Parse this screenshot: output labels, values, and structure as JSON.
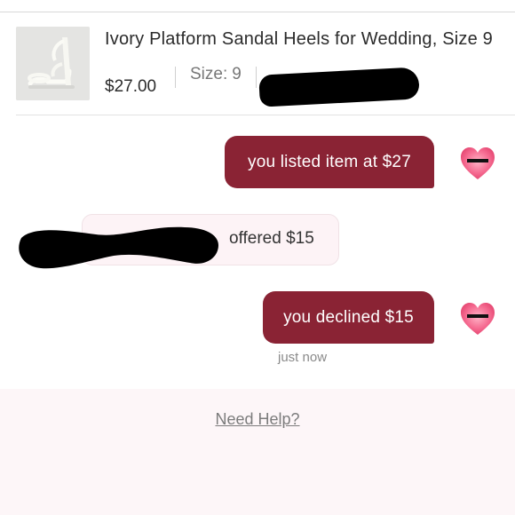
{
  "item": {
    "title": "Ivory Platform Sandal Heels for Wedding, Size 9",
    "price": "$27.00",
    "size_label": "Size:",
    "size_value": "9",
    "thumbnail_icon": "sandal-photo"
  },
  "messages": [
    {
      "text": "you listed item at $27",
      "sender": "self"
    },
    {
      "text": "offered $15",
      "sender": "buyer"
    },
    {
      "text": "you declined $15",
      "sender": "self"
    }
  ],
  "timestamp": "just now",
  "footer": {
    "help_link": "Need Help?"
  },
  "colors": {
    "bubble": "#8a2334",
    "offer_bubble_bg": "#fdf3f6",
    "footer_bg": "#fdf6f8",
    "avatar_heart": "#f25a83"
  }
}
